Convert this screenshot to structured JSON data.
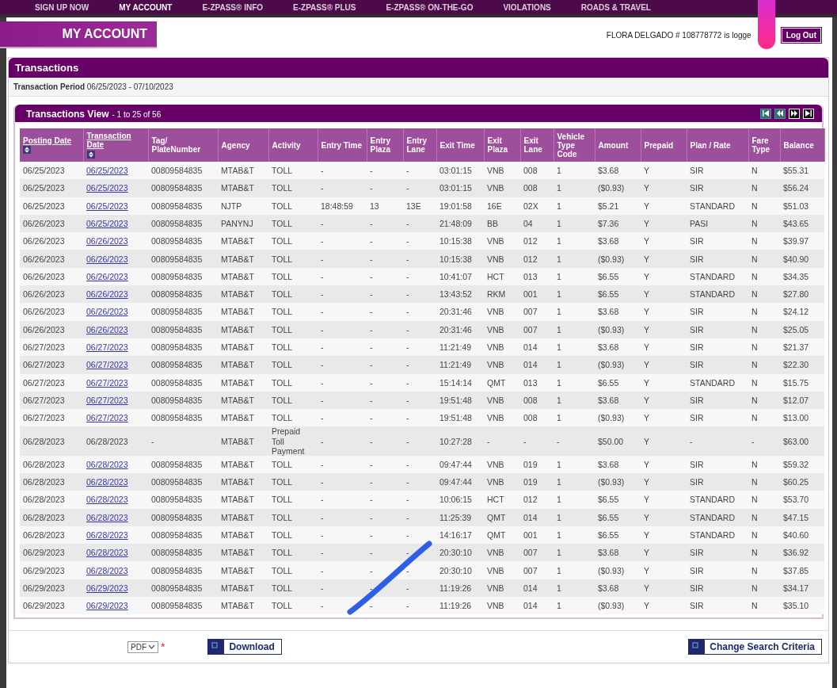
{
  "nav": [
    {
      "label": "SIGN UP NOW",
      "selected": false
    },
    {
      "label": "MY ACCOUNT",
      "selected": true
    },
    {
      "label": "E-ZPASS® INFO",
      "selected": false
    },
    {
      "label": "E-ZPASS® PLUS",
      "selected": false
    },
    {
      "label": "E-ZPASS® ON-THE-GO",
      "selected": false
    },
    {
      "label": "VIOLATIONS",
      "selected": false
    },
    {
      "label": "ROADS & TRAVEL",
      "selected": false
    }
  ],
  "page_title": "MY ACCOUNT",
  "user_status": "FLORA DELGADO # 108778772 is logge",
  "logout_button": "Log Out",
  "section_title": "Transactions",
  "period": {
    "label": "Transaction Period",
    "value": "06/25/2023 - 07/10/2023"
  },
  "view": {
    "title": "Transactions View",
    "range": "- 1 to 25 of 56"
  },
  "pager_buttons": [
    {
      "kind": "first",
      "disabled": true
    },
    {
      "kind": "prev",
      "disabled": true
    },
    {
      "kind": "next",
      "disabled": false
    },
    {
      "kind": "last",
      "disabled": false
    }
  ],
  "columns": [
    {
      "label": "Posting Date",
      "sortable": true
    },
    {
      "label": "Transaction Date",
      "sortable": true
    },
    {
      "label": "Tag/ PlateNumber",
      "sortable": false
    },
    {
      "label": "Agency",
      "sortable": false
    },
    {
      "label": "Activity",
      "sortable": false
    },
    {
      "label": "Entry Time",
      "sortable": false
    },
    {
      "label": "Entry Plaza",
      "sortable": false
    },
    {
      "label": "Entry Lane",
      "sortable": false
    },
    {
      "label": "Exit Time",
      "sortable": false
    },
    {
      "label": "Exit Plaza",
      "sortable": false
    },
    {
      "label": "Exit Lane",
      "sortable": false
    },
    {
      "label": "Vehicle Type Code",
      "sortable": false
    },
    {
      "label": "Amount",
      "sortable": false
    },
    {
      "label": "Prepaid",
      "sortable": false
    },
    {
      "label": "Plan / Rate",
      "sortable": false
    },
    {
      "label": "Fare Type",
      "sortable": false
    },
    {
      "label": "Balance",
      "sortable": false
    }
  ],
  "rows": [
    {
      "link": true,
      "cells": [
        "06/25/2023",
        "06/25/2023",
        "00809584835",
        "MTAB&T",
        "TOLL",
        "-",
        "-",
        "-",
        "03:01:15",
        "VNB",
        "008",
        "1",
        "$3.68",
        "Y",
        "SIR",
        "N",
        "$55.31"
      ]
    },
    {
      "link": true,
      "cells": [
        "06/25/2023",
        "06/25/2023",
        "00809584835",
        "MTAB&T",
        "TOLL",
        "-",
        "-",
        "-",
        "03:01:15",
        "VNB",
        "008",
        "1",
        "($0.93)",
        "Y",
        "SIR",
        "N",
        "$56.24"
      ]
    },
    {
      "link": true,
      "cells": [
        "06/25/2023",
        "06/25/2023",
        "00809584835",
        "NJTP",
        "TOLL",
        "18:48:59",
        "13",
        "13E",
        "19:01:58",
        "16E",
        "02X",
        "1",
        "$5.21",
        "Y",
        "STANDARD",
        "N",
        "$51.03"
      ]
    },
    {
      "link": true,
      "cells": [
        "06/26/2023",
        "06/25/2023",
        "00809584835",
        "PANYNJ",
        "TOLL",
        "-",
        "-",
        "-",
        "21:48:09",
        "BB",
        "04",
        "1",
        "$7.36",
        "Y",
        "PASI",
        "N",
        "$43.65"
      ]
    },
    {
      "link": true,
      "cells": [
        "06/26/2023",
        "06/26/2023",
        "00809584835",
        "MTAB&T",
        "TOLL",
        "-",
        "-",
        "-",
        "10:15:38",
        "VNB",
        "012",
        "1",
        "$3.68",
        "Y",
        "SIR",
        "N",
        "$39.97"
      ]
    },
    {
      "link": true,
      "cells": [
        "06/26/2023",
        "06/26/2023",
        "00809584835",
        "MTAB&T",
        "TOLL",
        "-",
        "-",
        "-",
        "10:15:38",
        "VNB",
        "012",
        "1",
        "($0.93)",
        "Y",
        "SIR",
        "N",
        "$40.90"
      ]
    },
    {
      "link": true,
      "cells": [
        "06/26/2023",
        "06/26/2023",
        "00809584835",
        "MTAB&T",
        "TOLL",
        "-",
        "-",
        "-",
        "10:41:07",
        "HCT",
        "013",
        "1",
        "$6.55",
        "Y",
        "STANDARD",
        "N",
        "$34.35"
      ]
    },
    {
      "link": true,
      "cells": [
        "06/26/2023",
        "06/26/2023",
        "00809584835",
        "MTAB&T",
        "TOLL",
        "-",
        "-",
        "-",
        "13:43:52",
        "RKM",
        "001",
        "1",
        "$6.55",
        "Y",
        "STANDARD",
        "N",
        "$27.80"
      ]
    },
    {
      "link": true,
      "cells": [
        "06/26/2023",
        "06/26/2023",
        "00809584835",
        "MTAB&T",
        "TOLL",
        "-",
        "-",
        "-",
        "20:31:46",
        "VNB",
        "007",
        "1",
        "$3.68",
        "Y",
        "SIR",
        "N",
        "$24.12"
      ]
    },
    {
      "link": true,
      "cells": [
        "06/26/2023",
        "06/26/2023",
        "00809584835",
        "MTAB&T",
        "TOLL",
        "-",
        "-",
        "-",
        "20:31:46",
        "VNB",
        "007",
        "1",
        "($0.93)",
        "Y",
        "SIR",
        "N",
        "$25.05"
      ]
    },
    {
      "link": true,
      "cells": [
        "06/27/2023",
        "06/27/2023",
        "00809584835",
        "MTAB&T",
        "TOLL",
        "-",
        "-",
        "-",
        "11:21:49",
        "VNB",
        "014",
        "1",
        "$3.68",
        "Y",
        "SIR",
        "N",
        "$21.37"
      ]
    },
    {
      "link": true,
      "cells": [
        "06/27/2023",
        "06/27/2023",
        "00809584835",
        "MTAB&T",
        "TOLL",
        "-",
        "-",
        "-",
        "11:21:49",
        "VNB",
        "014",
        "1",
        "($0.93)",
        "Y",
        "SIR",
        "N",
        "$22.30"
      ]
    },
    {
      "link": true,
      "cells": [
        "06/27/2023",
        "06/27/2023",
        "00809584835",
        "MTAB&T",
        "TOLL",
        "-",
        "-",
        "-",
        "15:14:14",
        "QMT",
        "013",
        "1",
        "$6.55",
        "Y",
        "STANDARD",
        "N",
        "$15.75"
      ]
    },
    {
      "link": true,
      "cells": [
        "06/27/2023",
        "06/27/2023",
        "00809584835",
        "MTAB&T",
        "TOLL",
        "-",
        "-",
        "-",
        "19:51:48",
        "VNB",
        "008",
        "1",
        "$3.68",
        "Y",
        "SIR",
        "N",
        "$12.07"
      ]
    },
    {
      "link": true,
      "cells": [
        "06/27/2023",
        "06/27/2023",
        "00809584835",
        "MTAB&T",
        "TOLL",
        "-",
        "-",
        "-",
        "19:51:48",
        "VNB",
        "008",
        "1",
        "($0.93)",
        "Y",
        "SIR",
        "N",
        "$13.00"
      ]
    },
    {
      "link": false,
      "cells": [
        "06/28/2023",
        "06/28/2023",
        "-",
        "MTAB&T",
        "Prepaid Toll Payment",
        "-",
        "-",
        "-",
        "10:27:28",
        "-",
        "-",
        "-",
        "$50.00",
        "Y",
        "-",
        "-",
        "$63.00"
      ]
    },
    {
      "link": true,
      "cells": [
        "06/28/2023",
        "06/28/2023",
        "00809584835",
        "MTAB&T",
        "TOLL",
        "-",
        "-",
        "-",
        "09:47:44",
        "VNB",
        "019",
        "1",
        "$3.68",
        "Y",
        "SIR",
        "N",
        "$59.32"
      ]
    },
    {
      "link": true,
      "cells": [
        "06/28/2023",
        "06/28/2023",
        "00809584835",
        "MTAB&T",
        "TOLL",
        "-",
        "-",
        "-",
        "09:47:44",
        "VNB",
        "019",
        "1",
        "($0.93)",
        "Y",
        "SIR",
        "N",
        "$60.25"
      ]
    },
    {
      "link": true,
      "cells": [
        "06/28/2023",
        "06/28/2023",
        "00809584835",
        "MTAB&T",
        "TOLL",
        "-",
        "-",
        "-",
        "10:06:15",
        "HCT",
        "012",
        "1",
        "$6.55",
        "Y",
        "STANDARD",
        "N",
        "$53.70"
      ]
    },
    {
      "link": true,
      "cells": [
        "06/28/2023",
        "06/28/2023",
        "00809584835",
        "MTAB&T",
        "TOLL",
        "-",
        "-",
        "-",
        "11:25:39",
        "QMT",
        "014",
        "1",
        "$6.55",
        "Y",
        "STANDARD",
        "N",
        "$47.15"
      ]
    },
    {
      "link": true,
      "cells": [
        "06/28/2023",
        "06/28/2023",
        "00809584835",
        "MTAB&T",
        "TOLL",
        "-",
        "-",
        "-",
        "14:16:17",
        "QMT",
        "001",
        "1",
        "$6.55",
        "Y",
        "STANDARD",
        "N",
        "$40.60"
      ]
    },
    {
      "link": true,
      "cells": [
        "06/29/2023",
        "06/28/2023",
        "00809584835",
        "MTAB&T",
        "TOLL",
        "-",
        "-",
        "-",
        "20:30:10",
        "VNB",
        "007",
        "1",
        "$3.68",
        "Y",
        "SIR",
        "N",
        "$36.92"
      ]
    },
    {
      "link": true,
      "cells": [
        "06/29/2023",
        "06/28/2023",
        "00809584835",
        "MTAB&T",
        "TOLL",
        "-",
        "-",
        "-",
        "20:30:10",
        "VNB",
        "007",
        "1",
        "($0.93)",
        "Y",
        "SIR",
        "N",
        "$37.85"
      ]
    },
    {
      "link": true,
      "cells": [
        "06/29/2023",
        "06/29/2023",
        "00809584835",
        "MTAB&T",
        "TOLL",
        "-",
        "-",
        "-",
        "11:19:26",
        "VNB",
        "014",
        "1",
        "$3.68",
        "Y",
        "SIR",
        "N",
        "$34.17"
      ]
    },
    {
      "link": true,
      "cells": [
        "06/29/2023",
        "06/29/2023",
        "00809584835",
        "MTAB&T",
        "TOLL",
        "-",
        "-",
        "-",
        "11:19:26",
        "VNB",
        "014",
        "1",
        "($0.93)",
        "Y",
        "SIR",
        "N",
        "$35.10"
      ]
    }
  ],
  "format_select": {
    "value": "PDF",
    "required_mark": "*"
  },
  "download_button": "Download",
  "change_button": "Change Search Criteria"
}
